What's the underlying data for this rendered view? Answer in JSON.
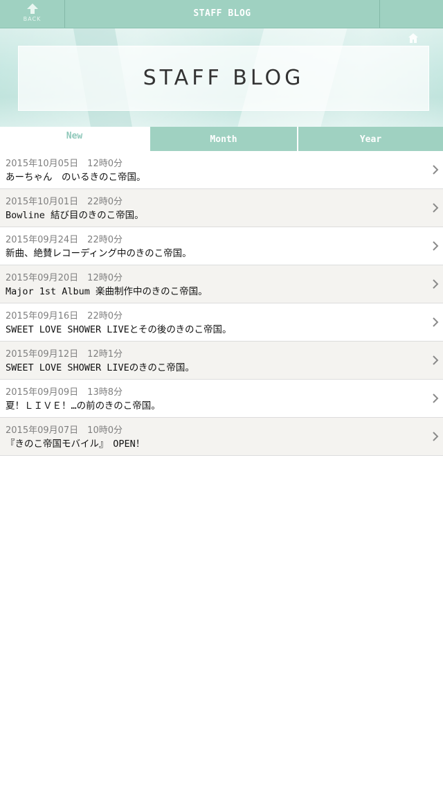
{
  "header": {
    "back_label": "BACK",
    "title": "STAFF BLOG"
  },
  "hero": {
    "title": "STAFF BLOG"
  },
  "icons": {
    "back": "back-arrow-icon",
    "home": "home-icon",
    "chevron": "chevron-right-icon"
  },
  "colors": {
    "accent": "#9fd1c1",
    "active_tab_text": "#8fc8ba",
    "alt_row": "#f4f3f0"
  },
  "tabs": [
    {
      "label": "New",
      "active": true
    },
    {
      "label": "Month",
      "active": false
    },
    {
      "label": "Year",
      "active": false
    }
  ],
  "posts": [
    {
      "date": "2015年10月05日　12時0分",
      "title": "あーちゃん　のいるきのこ帝国。"
    },
    {
      "date": "2015年10月01日　22時0分",
      "title": "Bowline 結び目のきのこ帝国。"
    },
    {
      "date": "2015年09月24日　22時0分",
      "title": "新曲、絶賛レコーディング中のきのこ帝国。"
    },
    {
      "date": "2015年09月20日　12時0分",
      "title": "Major 1st Album 楽曲制作中のきのこ帝国。"
    },
    {
      "date": "2015年09月16日　22時0分",
      "title": "SWEET LOVE SHOWER LIVEとその後のきのこ帝国。"
    },
    {
      "date": "2015年09月12日　12時1分",
      "title": "SWEET LOVE SHOWER LIVEのきのこ帝国。"
    },
    {
      "date": "2015年09月09日　13時8分",
      "title": "夏！ＬＩＶＥ！…の前のきのこ帝国。"
    },
    {
      "date": "2015年09月07日　10時0分",
      "title": "『きのこ帝国モバイル』　OPEN！"
    }
  ]
}
